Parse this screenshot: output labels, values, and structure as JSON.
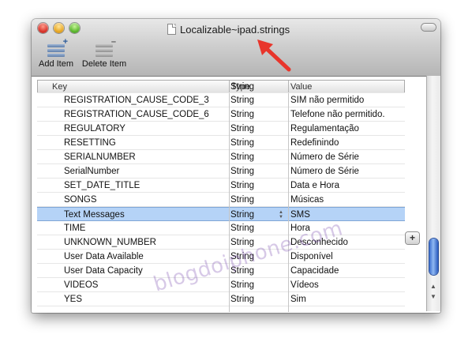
{
  "window": {
    "title": "Localizable~ipad.strings"
  },
  "toolbar": {
    "add_label": "Add Item",
    "delete_label": "Delete Item"
  },
  "table": {
    "headers": {
      "key": "Key",
      "type": "Type",
      "value": "Value"
    },
    "rows": [
      {
        "key": "REGISTRATION_CAUSE_CODE_3",
        "type": "String",
        "value": "SIM não permitido"
      },
      {
        "key": "REGISTRATION_CAUSE_CODE_6",
        "type": "String",
        "value": "Telefone não permitido."
      },
      {
        "key": "REGULATORY",
        "type": "String",
        "value": "Regulamentação"
      },
      {
        "key": "RESETTING",
        "type": "String",
        "value": "Redefinindo"
      },
      {
        "key": "SERIALNUMBER",
        "type": "String",
        "value": "Número de Série"
      },
      {
        "key": "SerialNumber",
        "type": "String",
        "value": "Número de Série"
      },
      {
        "key": "SET_DATE_TITLE",
        "type": "String",
        "value": "Data e Hora"
      },
      {
        "key": "SONGS",
        "type": "String",
        "value": "Músicas"
      },
      {
        "key": "Text Messages",
        "type": "String",
        "value": "SMS"
      },
      {
        "key": "TIME",
        "type": "String",
        "value": "Hora"
      },
      {
        "key": "UNKNOWN_NUMBER",
        "type": "String",
        "value": "Desconhecido"
      },
      {
        "key": "User Data Available",
        "type": "String",
        "value": "Disponível"
      },
      {
        "key": "User Data Capacity",
        "type": "String",
        "value": "Capacidade"
      },
      {
        "key": "VIDEOS",
        "type": "String",
        "value": "Vídeos"
      },
      {
        "key": "YES",
        "type": "String",
        "value": "Sim"
      }
    ],
    "partial_row_type": "String",
    "selected_row": "Text Messages"
  },
  "watermark": "blogdoiphone.com",
  "colors": {
    "selection": "#b5d3f7",
    "scroll_thumb": "#3c6fd0",
    "arrow": "#e8352b"
  }
}
